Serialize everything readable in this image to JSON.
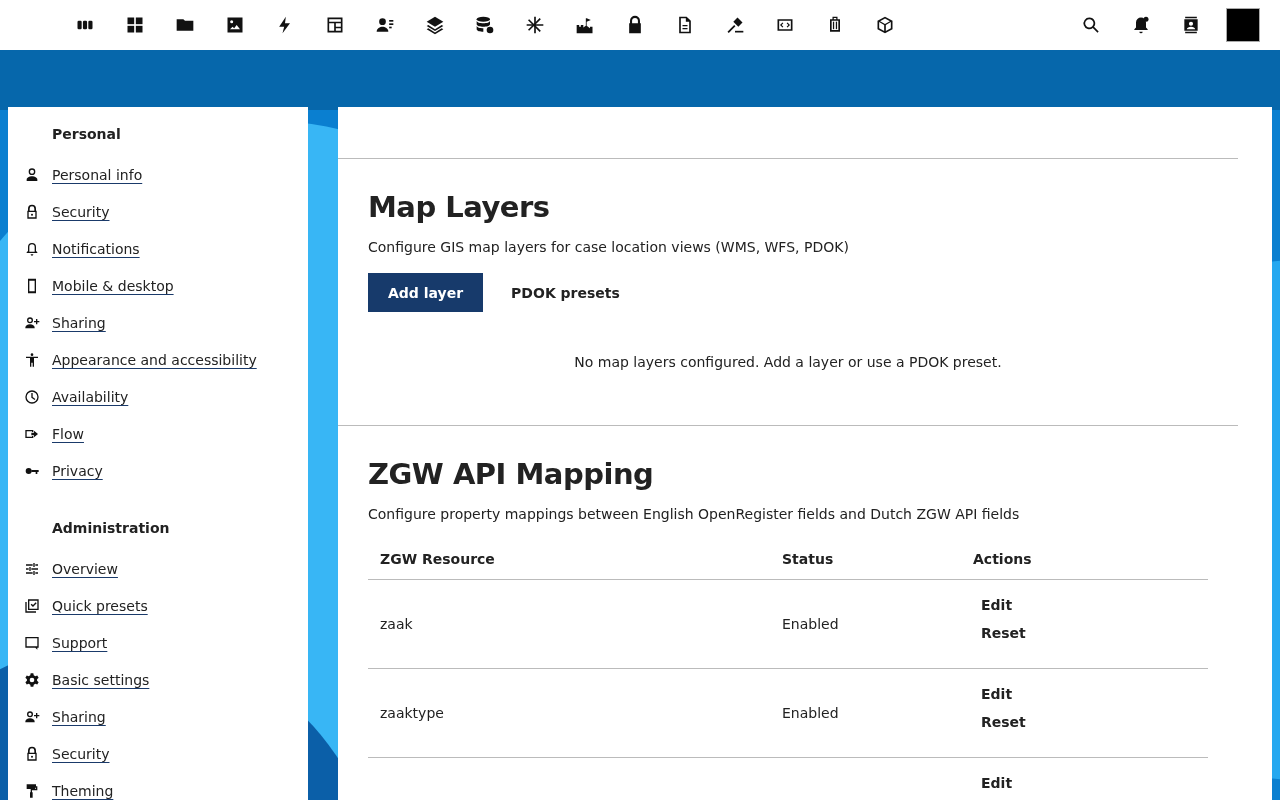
{
  "sidebar": {
    "sections": [
      {
        "title": "Personal",
        "items": [
          "Personal info",
          "Security",
          "Notifications",
          "Mobile & desktop",
          "Sharing",
          "Appearance and accessibility",
          "Availability",
          "Flow",
          "Privacy"
        ]
      },
      {
        "title": "Administration",
        "items": [
          "Overview",
          "Quick presets",
          "Support",
          "Basic settings",
          "Sharing",
          "Security",
          "Theming"
        ]
      }
    ]
  },
  "map_layers": {
    "title": "Map Layers",
    "description": "Configure GIS map layers for case location views (WMS, WFS, PDOK)",
    "buttons": [
      {
        "label": "Add layer",
        "kind": "primary"
      },
      {
        "label": "PDOK presets",
        "kind": "tertiary"
      }
    ],
    "empty_message": "No map layers configured. Add a layer or use a PDOK preset."
  },
  "zgw_mapping": {
    "title": "ZGW API Mapping",
    "description": "Configure property mappings between English OpenRegister fields and Dutch ZGW API fields",
    "table": {
      "columns": [
        "ZGW Resource",
        "Status",
        "Actions"
      ],
      "rows": [
        {
          "resource": "zaak",
          "status": "Enabled",
          "actions": [
            "Edit",
            "Reset"
          ]
        },
        {
          "resource": "zaaktype",
          "status": "Enabled",
          "actions": [
            "Edit",
            "Reset"
          ]
        },
        {
          "actions": [
            "Edit"
          ]
        }
      ]
    }
  }
}
